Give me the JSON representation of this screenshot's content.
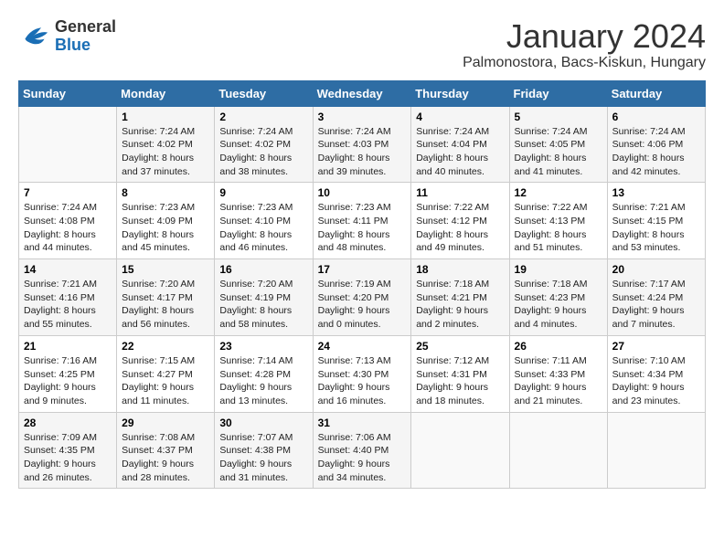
{
  "header": {
    "logo_line1": "General",
    "logo_line2": "Blue",
    "title": "January 2024",
    "subtitle": "Palmonostora, Bacs-Kiskun, Hungary"
  },
  "days_of_week": [
    "Sunday",
    "Monday",
    "Tuesday",
    "Wednesday",
    "Thursday",
    "Friday",
    "Saturday"
  ],
  "weeks": [
    [
      {
        "day": "",
        "sunrise": "",
        "sunset": "",
        "daylight": ""
      },
      {
        "day": "1",
        "sunrise": "Sunrise: 7:24 AM",
        "sunset": "Sunset: 4:02 PM",
        "daylight": "Daylight: 8 hours and 37 minutes."
      },
      {
        "day": "2",
        "sunrise": "Sunrise: 7:24 AM",
        "sunset": "Sunset: 4:02 PM",
        "daylight": "Daylight: 8 hours and 38 minutes."
      },
      {
        "day": "3",
        "sunrise": "Sunrise: 7:24 AM",
        "sunset": "Sunset: 4:03 PM",
        "daylight": "Daylight: 8 hours and 39 minutes."
      },
      {
        "day": "4",
        "sunrise": "Sunrise: 7:24 AM",
        "sunset": "Sunset: 4:04 PM",
        "daylight": "Daylight: 8 hours and 40 minutes."
      },
      {
        "day": "5",
        "sunrise": "Sunrise: 7:24 AM",
        "sunset": "Sunset: 4:05 PM",
        "daylight": "Daylight: 8 hours and 41 minutes."
      },
      {
        "day": "6",
        "sunrise": "Sunrise: 7:24 AM",
        "sunset": "Sunset: 4:06 PM",
        "daylight": "Daylight: 8 hours and 42 minutes."
      }
    ],
    [
      {
        "day": "7",
        "sunrise": "Sunrise: 7:24 AM",
        "sunset": "Sunset: 4:08 PM",
        "daylight": "Daylight: 8 hours and 44 minutes."
      },
      {
        "day": "8",
        "sunrise": "Sunrise: 7:23 AM",
        "sunset": "Sunset: 4:09 PM",
        "daylight": "Daylight: 8 hours and 45 minutes."
      },
      {
        "day": "9",
        "sunrise": "Sunrise: 7:23 AM",
        "sunset": "Sunset: 4:10 PM",
        "daylight": "Daylight: 8 hours and 46 minutes."
      },
      {
        "day": "10",
        "sunrise": "Sunrise: 7:23 AM",
        "sunset": "Sunset: 4:11 PM",
        "daylight": "Daylight: 8 hours and 48 minutes."
      },
      {
        "day": "11",
        "sunrise": "Sunrise: 7:22 AM",
        "sunset": "Sunset: 4:12 PM",
        "daylight": "Daylight: 8 hours and 49 minutes."
      },
      {
        "day": "12",
        "sunrise": "Sunrise: 7:22 AM",
        "sunset": "Sunset: 4:13 PM",
        "daylight": "Daylight: 8 hours and 51 minutes."
      },
      {
        "day": "13",
        "sunrise": "Sunrise: 7:21 AM",
        "sunset": "Sunset: 4:15 PM",
        "daylight": "Daylight: 8 hours and 53 minutes."
      }
    ],
    [
      {
        "day": "14",
        "sunrise": "Sunrise: 7:21 AM",
        "sunset": "Sunset: 4:16 PM",
        "daylight": "Daylight: 8 hours and 55 minutes."
      },
      {
        "day": "15",
        "sunrise": "Sunrise: 7:20 AM",
        "sunset": "Sunset: 4:17 PM",
        "daylight": "Daylight: 8 hours and 56 minutes."
      },
      {
        "day": "16",
        "sunrise": "Sunrise: 7:20 AM",
        "sunset": "Sunset: 4:19 PM",
        "daylight": "Daylight: 8 hours and 58 minutes."
      },
      {
        "day": "17",
        "sunrise": "Sunrise: 7:19 AM",
        "sunset": "Sunset: 4:20 PM",
        "daylight": "Daylight: 9 hours and 0 minutes."
      },
      {
        "day": "18",
        "sunrise": "Sunrise: 7:18 AM",
        "sunset": "Sunset: 4:21 PM",
        "daylight": "Daylight: 9 hours and 2 minutes."
      },
      {
        "day": "19",
        "sunrise": "Sunrise: 7:18 AM",
        "sunset": "Sunset: 4:23 PM",
        "daylight": "Daylight: 9 hours and 4 minutes."
      },
      {
        "day": "20",
        "sunrise": "Sunrise: 7:17 AM",
        "sunset": "Sunset: 4:24 PM",
        "daylight": "Daylight: 9 hours and 7 minutes."
      }
    ],
    [
      {
        "day": "21",
        "sunrise": "Sunrise: 7:16 AM",
        "sunset": "Sunset: 4:25 PM",
        "daylight": "Daylight: 9 hours and 9 minutes."
      },
      {
        "day": "22",
        "sunrise": "Sunrise: 7:15 AM",
        "sunset": "Sunset: 4:27 PM",
        "daylight": "Daylight: 9 hours and 11 minutes."
      },
      {
        "day": "23",
        "sunrise": "Sunrise: 7:14 AM",
        "sunset": "Sunset: 4:28 PM",
        "daylight": "Daylight: 9 hours and 13 minutes."
      },
      {
        "day": "24",
        "sunrise": "Sunrise: 7:13 AM",
        "sunset": "Sunset: 4:30 PM",
        "daylight": "Daylight: 9 hours and 16 minutes."
      },
      {
        "day": "25",
        "sunrise": "Sunrise: 7:12 AM",
        "sunset": "Sunset: 4:31 PM",
        "daylight": "Daylight: 9 hours and 18 minutes."
      },
      {
        "day": "26",
        "sunrise": "Sunrise: 7:11 AM",
        "sunset": "Sunset: 4:33 PM",
        "daylight": "Daylight: 9 hours and 21 minutes."
      },
      {
        "day": "27",
        "sunrise": "Sunrise: 7:10 AM",
        "sunset": "Sunset: 4:34 PM",
        "daylight": "Daylight: 9 hours and 23 minutes."
      }
    ],
    [
      {
        "day": "28",
        "sunrise": "Sunrise: 7:09 AM",
        "sunset": "Sunset: 4:35 PM",
        "daylight": "Daylight: 9 hours and 26 minutes."
      },
      {
        "day": "29",
        "sunrise": "Sunrise: 7:08 AM",
        "sunset": "Sunset: 4:37 PM",
        "daylight": "Daylight: 9 hours and 28 minutes."
      },
      {
        "day": "30",
        "sunrise": "Sunrise: 7:07 AM",
        "sunset": "Sunset: 4:38 PM",
        "daylight": "Daylight: 9 hours and 31 minutes."
      },
      {
        "day": "31",
        "sunrise": "Sunrise: 7:06 AM",
        "sunset": "Sunset: 4:40 PM",
        "daylight": "Daylight: 9 hours and 34 minutes."
      },
      {
        "day": "",
        "sunrise": "",
        "sunset": "",
        "daylight": ""
      },
      {
        "day": "",
        "sunrise": "",
        "sunset": "",
        "daylight": ""
      },
      {
        "day": "",
        "sunrise": "",
        "sunset": "",
        "daylight": ""
      }
    ]
  ]
}
